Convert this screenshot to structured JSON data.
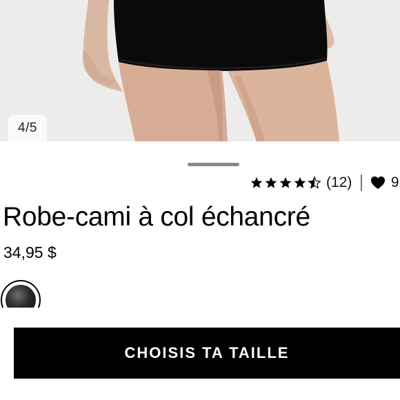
{
  "gallery": {
    "counter": "4/5"
  },
  "product": {
    "rating": 4.5,
    "rating_max": 5,
    "review_count": "(12)",
    "favorites_count": "9",
    "title": "Robe-cami à col échancré",
    "price": "34,95 $",
    "selected_color": "#1a1a1a"
  },
  "actions": {
    "size_button_label": "CHOISIS TA TAILLE"
  },
  "icons": {
    "rating": "star-icon",
    "favorite": "heart-icon"
  }
}
